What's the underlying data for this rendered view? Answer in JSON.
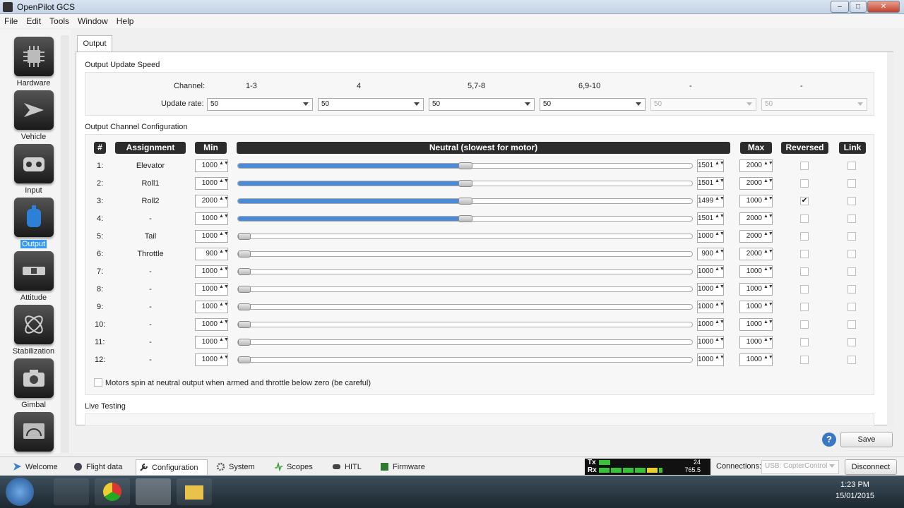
{
  "window": {
    "title": "OpenPilot GCS",
    "btn_min": "–",
    "btn_max": "□",
    "btn_close": "✕"
  },
  "menu": [
    "File",
    "Edit",
    "Tools",
    "Window",
    "Help"
  ],
  "nav": [
    {
      "label": "Hardware",
      "icon": "chip-icon"
    },
    {
      "label": "Vehicle",
      "icon": "aircraft-icon"
    },
    {
      "label": "Input",
      "icon": "transmitter-icon"
    },
    {
      "label": "Output",
      "icon": "motor-icon"
    },
    {
      "label": "Attitude",
      "icon": "level-icon"
    },
    {
      "label": "Stabilization",
      "icon": "gyro-icon"
    },
    {
      "label": "Gimbal",
      "icon": "camera-icon"
    }
  ],
  "tab": "Output",
  "update_speed": {
    "title": "Output Update Speed",
    "channel_label": "Channel:",
    "rate_label": "Update rate:",
    "channels": [
      "1-3",
      "4",
      "5,7-8",
      "6,9-10",
      "-",
      "-"
    ],
    "rates": [
      "50",
      "50",
      "50",
      "50",
      "50",
      "50"
    ],
    "disabled": [
      false,
      false,
      false,
      false,
      true,
      true
    ]
  },
  "channel_config": {
    "title": "Output Channel Configuration",
    "headers": {
      "num": "#",
      "assignment": "Assignment",
      "min": "Min",
      "neutral": "Neutral (slowest for motor)",
      "max": "Max",
      "reversed": "Reversed",
      "link": "Link"
    },
    "rows": [
      {
        "num": "1:",
        "assign": "Elevator",
        "min": "1000",
        "neutral": "1501",
        "max": "2000",
        "rev": false,
        "pos": 0.5,
        "active": true
      },
      {
        "num": "2:",
        "assign": "Roll1",
        "min": "1000",
        "neutral": "1501",
        "max": "2000",
        "rev": false,
        "pos": 0.5,
        "active": true
      },
      {
        "num": "3:",
        "assign": "Roll2",
        "min": "2000",
        "neutral": "1499",
        "max": "1000",
        "rev": true,
        "pos": 0.5,
        "active": true
      },
      {
        "num": "4:",
        "assign": "-",
        "min": "1000",
        "neutral": "1501",
        "max": "2000",
        "rev": false,
        "pos": 0.5,
        "active": true
      },
      {
        "num": "5:",
        "assign": "Tail",
        "min": "1000",
        "neutral": "1000",
        "max": "2000",
        "rev": false,
        "pos": 0,
        "active": false
      },
      {
        "num": "6:",
        "assign": "Throttle",
        "min": "900",
        "neutral": "900",
        "max": "2000",
        "rev": false,
        "pos": 0,
        "active": false
      },
      {
        "num": "7:",
        "assign": "-",
        "min": "1000",
        "neutral": "1000",
        "max": "1000",
        "rev": false,
        "pos": 0,
        "active": false
      },
      {
        "num": "8:",
        "assign": "-",
        "min": "1000",
        "neutral": "1000",
        "max": "1000",
        "rev": false,
        "pos": 0,
        "active": false
      },
      {
        "num": "9:",
        "assign": "-",
        "min": "1000",
        "neutral": "1000",
        "max": "1000",
        "rev": false,
        "pos": 0,
        "active": false
      },
      {
        "num": "10:",
        "assign": "-",
        "min": "1000",
        "neutral": "1000",
        "max": "1000",
        "rev": false,
        "pos": 0,
        "active": false
      },
      {
        "num": "11:",
        "assign": "-",
        "min": "1000",
        "neutral": "1000",
        "max": "1000",
        "rev": false,
        "pos": 0,
        "active": false
      },
      {
        "num": "12:",
        "assign": "-",
        "min": "1000",
        "neutral": "1000",
        "max": "1000",
        "rev": false,
        "pos": 0,
        "active": false
      }
    ],
    "motors_checkbox": "Motors spin at neutral output when armed and throttle below zero (be careful)"
  },
  "live_testing": {
    "title": "Live Testing"
  },
  "save_label": "Save",
  "workspaces": [
    {
      "label": "Welcome",
      "icon": "openpilot-icon"
    },
    {
      "label": "Flight data",
      "icon": "globe-icon"
    },
    {
      "label": "Configuration",
      "icon": "wrench-icon"
    },
    {
      "label": "System",
      "icon": "gear-icon"
    },
    {
      "label": "Scopes",
      "icon": "scope-icon"
    },
    {
      "label": "HITL",
      "icon": "gamepad-icon"
    },
    {
      "label": "Firmware",
      "icon": "chip-icon"
    }
  ],
  "telemetry": {
    "tx_label": "Tx",
    "rx_label": "Rx",
    "tx_value": "24",
    "rx_value": "765.5"
  },
  "connections": {
    "label": "Connections:",
    "device": "USB: CopterControl",
    "disconnect": "Disconnect"
  },
  "clock": {
    "time": "1:23 PM",
    "date": "15/01/2015"
  },
  "colors": {
    "accent": "#3399ff",
    "slider_fill": "#4a8ad6",
    "header_bg": "#2c2c2c"
  }
}
